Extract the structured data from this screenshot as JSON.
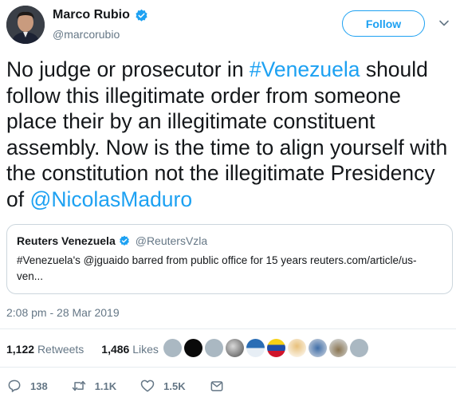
{
  "author": {
    "name": "Marco Rubio",
    "handle": "@marcorubio",
    "verified_icon": "verified-badge-icon"
  },
  "header": {
    "follow_label": "Follow",
    "more_icon": "chevron-down-icon"
  },
  "tweet": {
    "segments": [
      "No judge or prosecutor in ",
      "#Venezuela",
      " should follow this illegitimate order from someone place their by an illegitimate constituent assembly. Now is the time to align yourself with the constitution not the illegitimate Presidency of ",
      "@NicolasMaduro"
    ]
  },
  "quote": {
    "name": "Reuters Venezuela",
    "handle": "@ReutersVzla",
    "text": "#Venezuela's @jguaido barred from public office for 15 years reuters.com/article/us-ven..."
  },
  "timestamp": "2:08 pm - 28 Mar 2019",
  "stats": {
    "retweets_count": "1,122",
    "retweets_label": "Retweets",
    "likes_count": "1,486",
    "likes_label": "Likes"
  },
  "actions": {
    "replies": "138",
    "retweets": "1.1K",
    "likes": "1.5K"
  },
  "colors": {
    "accent": "#1da1f2",
    "text": "#14171a",
    "muted": "#657786",
    "border": "#ccd6dd"
  }
}
